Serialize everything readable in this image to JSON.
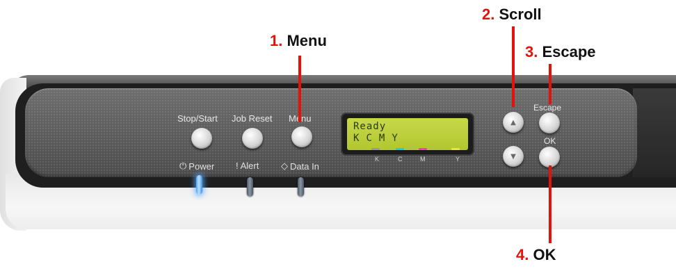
{
  "panel_buttons": {
    "stop_start": "Stop/Start",
    "job_reset": "Job Reset",
    "menu": "Menu",
    "escape": "Escape",
    "ok": "OK"
  },
  "indicators": {
    "power": {
      "symbol": "⏻",
      "label": "Power",
      "state": "on"
    },
    "alert": {
      "symbol": "!",
      "label": "Alert",
      "state": "off"
    },
    "data_in": {
      "symbol": "◇",
      "label": "Data In",
      "state": "off"
    }
  },
  "lcd": {
    "line1": "Ready",
    "toner_status": [
      "K",
      "C",
      "M",
      "Y"
    ],
    "toner_labels": [
      "K",
      "C",
      "M",
      "Y"
    ],
    "toner_colors": [
      "#9a9a9a",
      "#25c6e6",
      "#e54ab0",
      "#f0e23a"
    ]
  },
  "annotations": [
    {
      "number": "1.",
      "text": "Menu"
    },
    {
      "number": "2.",
      "text": "Scroll"
    },
    {
      "number": "3.",
      "text": "Escape"
    },
    {
      "number": "4.",
      "text": "OK"
    }
  ],
  "colors": {
    "annotation_accent": "#e3120b",
    "lcd_background": "#b9cc38",
    "power_led": "#4aa7ff"
  }
}
